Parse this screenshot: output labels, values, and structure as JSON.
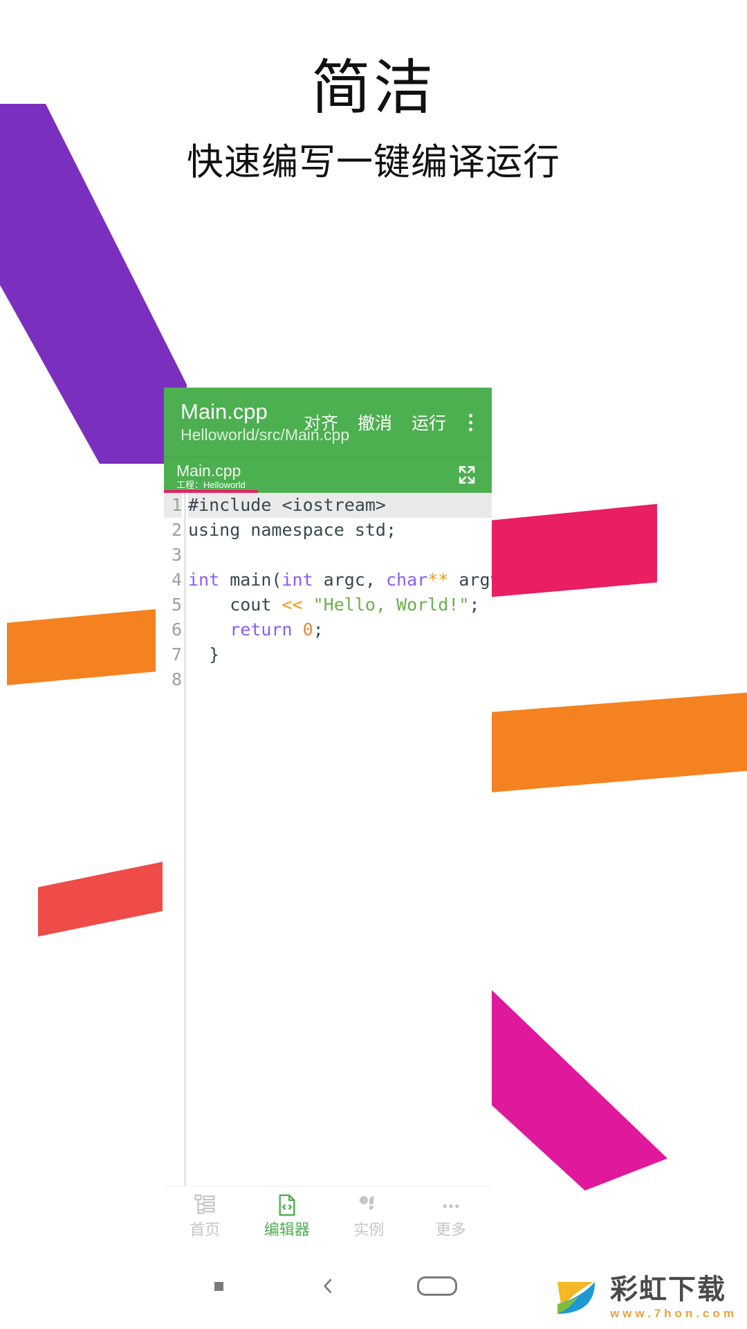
{
  "promo": {
    "title": "简洁",
    "subtitle": "快速编写一键编译运行"
  },
  "colors": {
    "brand_green": "#4CAF50",
    "accent_pink": "#E91E63",
    "deco_purple": "#7B2FBE",
    "deco_orange": "#F58220",
    "deco_red": "#EF4B48",
    "deco_magenta": "#E0189C",
    "keyword_purple": "#8B5CF6",
    "string_green": "#6AB04C",
    "operator_orange": "#F39C12"
  },
  "app": {
    "appbar": {
      "title": "Main.cpp",
      "subtitle": "Helloworld/src/Main.cpp",
      "actions": [
        {
          "label": "对齐",
          "name": "align-button"
        },
        {
          "label": "撤消",
          "name": "undo-button"
        },
        {
          "label": "运行",
          "name": "run-button"
        }
      ],
      "overflow_icon": "overflow-menu-icon"
    },
    "tab": {
      "file_name": "Main.cpp",
      "project_meta": "工程：Helloworld",
      "expand_icon": "fullscreen-expand-icon"
    },
    "editor": {
      "active_line": 1,
      "line_numbers": [
        "1",
        "2",
        "3",
        "4",
        "5",
        "6",
        "7",
        "8"
      ],
      "lines": [
        {
          "n": "1",
          "tokens": [
            {
              "t": "#include <iostream>",
              "c": "pp"
            }
          ]
        },
        {
          "n": "2",
          "tokens": [
            {
              "t": "using namespace std;",
              "c": "pp"
            }
          ]
        },
        {
          "n": "3",
          "tokens": [
            {
              "t": "",
              "c": "pp"
            }
          ]
        },
        {
          "n": "4",
          "tokens": [
            {
              "t": "int",
              "c": "kw"
            },
            {
              "t": " main(",
              "c": "pp"
            },
            {
              "t": "int",
              "c": "kw"
            },
            {
              "t": " argc, ",
              "c": "pp"
            },
            {
              "t": "char",
              "c": "kw"
            },
            {
              "t": "**",
              "c": "op"
            },
            {
              "t": " argv){",
              "c": "pp"
            }
          ]
        },
        {
          "n": "5",
          "tokens": [
            {
              "t": "    cout ",
              "c": "pp"
            },
            {
              "t": "<<",
              "c": "op"
            },
            {
              "t": " \"Hello, World!\"",
              "c": "str"
            },
            {
              "t": ";",
              "c": "pp"
            }
          ]
        },
        {
          "n": "6",
          "tokens": [
            {
              "t": "    ",
              "c": "pp"
            },
            {
              "t": "return",
              "c": "kw"
            },
            {
              "t": " ",
              "c": "pp"
            },
            {
              "t": "0",
              "c": "num"
            },
            {
              "t": ";",
              "c": "pp"
            }
          ]
        },
        {
          "n": "7",
          "tokens": [
            {
              "t": "  }",
              "c": "pp"
            }
          ]
        },
        {
          "n": "8",
          "tokens": [
            {
              "t": "",
              "c": "pp"
            }
          ]
        }
      ]
    },
    "bottom_nav": {
      "items": [
        {
          "label": "首页",
          "icon": "home-tree-icon",
          "active": false
        },
        {
          "label": "编辑器",
          "icon": "code-file-icon",
          "active": true
        },
        {
          "label": "实例",
          "icon": "examples-grid-icon",
          "active": false
        },
        {
          "label": "更多",
          "icon": "more-dots-icon",
          "active": false
        }
      ]
    }
  },
  "system_nav": {
    "recents_icon": "recents-square-icon",
    "back_icon": "back-chevron-icon",
    "home_icon": "home-pill-icon"
  },
  "watermark": {
    "title": "彩虹下载",
    "url": "www.7hon.com"
  }
}
